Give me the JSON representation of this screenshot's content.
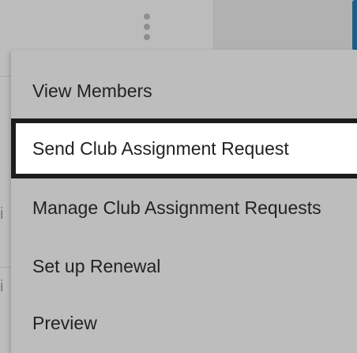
{
  "menu": {
    "items": [
      {
        "label": "View Members"
      },
      {
        "label": "Send Club Assignment Request"
      },
      {
        "label": "Manage Club Assignment Requests"
      },
      {
        "label": "Set up Renewal"
      },
      {
        "label": "Preview"
      }
    ],
    "selected_item": "Send Club Assignment Request"
  },
  "colors": {
    "overlay_background": "#bdbdbd",
    "selected_background": "#ffffff",
    "selected_border": "#1c1c1c",
    "accent_edge": "#1d5e86"
  },
  "icons": {
    "actions": "kebab-vertical-icon"
  }
}
